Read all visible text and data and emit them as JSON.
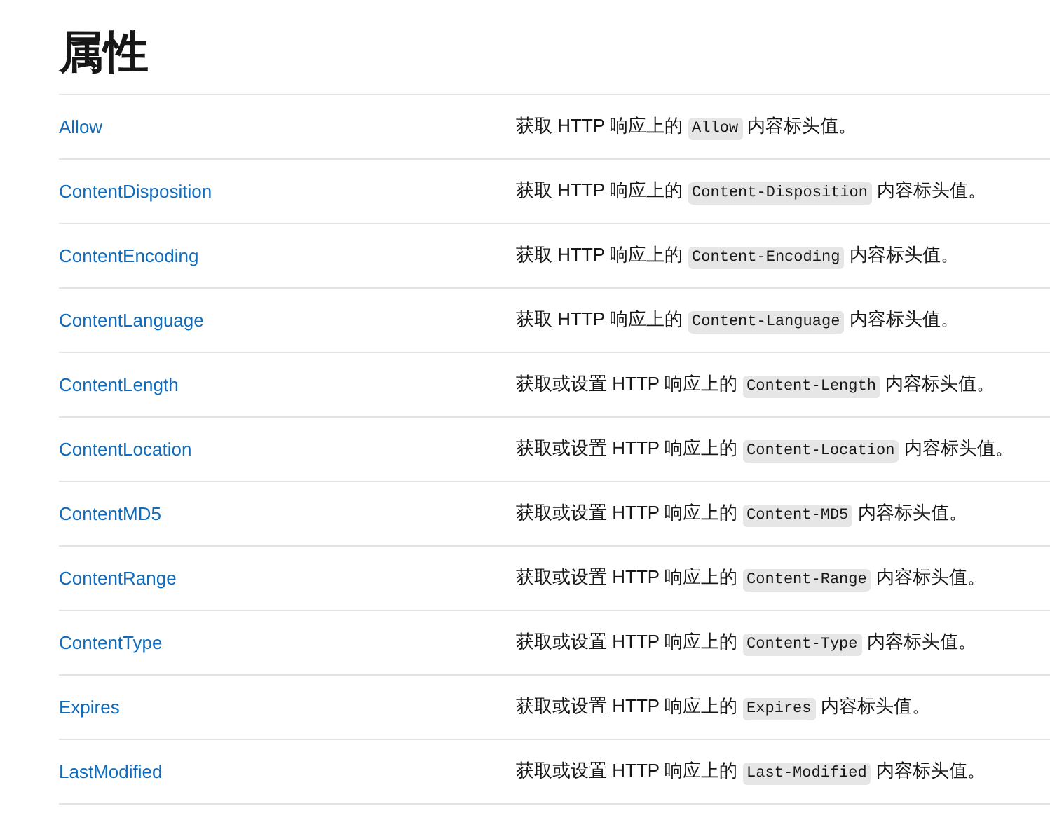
{
  "heading": "属性",
  "properties": [
    {
      "name": "Allow",
      "description": {
        "before": "获取 HTTP 响应上的 ",
        "code": "Allow",
        "after": " 内容标头值。"
      }
    },
    {
      "name": "ContentDisposition",
      "description": {
        "before": "获取 HTTP 响应上的 ",
        "code": "Content-Disposition",
        "after": " 内容标头值。"
      }
    },
    {
      "name": "ContentEncoding",
      "description": {
        "before": "获取 HTTP 响应上的 ",
        "code": "Content-Encoding",
        "after": " 内容标头值。"
      }
    },
    {
      "name": "ContentLanguage",
      "description": {
        "before": "获取 HTTP 响应上的 ",
        "code": "Content-Language",
        "after": " 内容标头值。"
      }
    },
    {
      "name": "ContentLength",
      "description": {
        "before": "获取或设置 HTTP 响应上的 ",
        "code": "Content-Length",
        "after": " 内容标头值。"
      }
    },
    {
      "name": "ContentLocation",
      "description": {
        "before": "获取或设置 HTTP 响应上的 ",
        "code": "Content-Location",
        "after": " 内容标头值。"
      }
    },
    {
      "name": "ContentMD5",
      "description": {
        "before": "获取或设置 HTTP 响应上的 ",
        "code": "Content-MD5",
        "after": " 内容标头值。"
      }
    },
    {
      "name": "ContentRange",
      "description": {
        "before": "获取或设置 HTTP 响应上的 ",
        "code": "Content-Range",
        "after": " 内容标头值。"
      }
    },
    {
      "name": "ContentType",
      "description": {
        "before": "获取或设置 HTTP 响应上的 ",
        "code": "Content-Type",
        "after": " 内容标头值。"
      }
    },
    {
      "name": "Expires",
      "description": {
        "before": "获取或设置 HTTP 响应上的 ",
        "code": "Expires",
        "after": " 内容标头值。"
      }
    },
    {
      "name": "LastModified",
      "description": {
        "before": "获取或设置 HTTP 响应上的 ",
        "code": "Last-Modified",
        "after": " 内容标头值。"
      }
    }
  ]
}
